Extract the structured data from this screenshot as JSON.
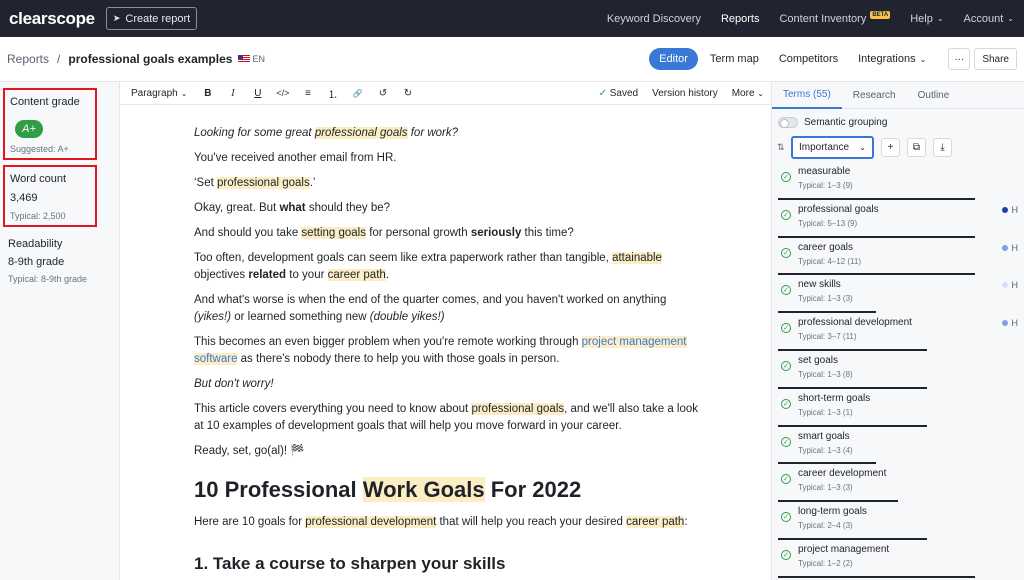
{
  "topnav": {
    "logo": "clearscope",
    "create_label": "Create report",
    "links": [
      {
        "label": "Keyword Discovery"
      },
      {
        "label": "Reports"
      },
      {
        "label": "Content Inventory",
        "badge": "BETA"
      },
      {
        "label": "Help"
      },
      {
        "label": "Account"
      }
    ]
  },
  "subhead": {
    "root": "Reports",
    "separator": "/",
    "page": "professional goals examples",
    "lang": "EN",
    "tabs": [
      "Editor",
      "Term map",
      "Competitors",
      "Integrations"
    ],
    "more_label": "···",
    "share_label": "Share"
  },
  "metrics": {
    "grade": {
      "label": "Content grade",
      "value": "A+",
      "sub": "Suggested: A+"
    },
    "wordcount": {
      "label": "Word count",
      "value": "3,469",
      "sub": "Typical: 2,500"
    },
    "readability": {
      "label": "Readability",
      "value": "8-9th grade",
      "sub": "Typical: 8-9th grade"
    }
  },
  "toolbar": {
    "paragraph": "Paragraph",
    "icons": [
      "B",
      "I",
      "U",
      "</>",
      "≡",
      "⒈",
      "🔗",
      "↺",
      "↻"
    ],
    "saved": "Saved",
    "version": "Version history",
    "more": "More"
  },
  "doc": {
    "p1a": "Looking for some great ",
    "p1b": "professional goals",
    "p1c": " for work?",
    "p2": "You've received another email from HR.",
    "p3a": "‘Set ",
    "p3b": "professional goals",
    "p3c": ".’",
    "p4a": "Okay, great. But ",
    "p4b": "what",
    "p4c": " should they be?",
    "p5a": "And should you take ",
    "p5b": "setting goals",
    "p5c": " for personal growth ",
    "p5d": "seriously",
    "p5e": " this time?",
    "p6a": "Too often, development goals can seem like extra paperwork rather than tangible, ",
    "p6b": "attainable",
    "p6c": " objectives ",
    "p6d": "related",
    "p6e": " to your ",
    "p6f": "career path",
    "p6g": ".",
    "p7a": "And what's worse is when the end of the quarter comes, and you haven't worked on anything ",
    "p7b": "(yikes!)",
    "p7c": " or learned something new ",
    "p7d": "(double yikes!)",
    "p8a": "This becomes an even bigger problem when you're remote working through ",
    "p8b": "project management software",
    "p8c": " as there's nobody there to help you with those goals in person.",
    "p9": "But don't worry!",
    "p10a": "This article covers everything you need to know about ",
    "p10b": "professional goals",
    "p10c": ", and we'll also take a look at 10 examples of development goals that will help you move forward in your career.",
    "p11": "Ready, set, go(al)! 🏁",
    "h2a": "10 Professional ",
    "h2b": "Work Goals",
    "h2c": " For 2022",
    "p12a": "Here are 10 goals for ",
    "p12b": "professional development",
    "p12c": " that will help you reach your desired ",
    "p12d": "career path",
    "p12e": ":",
    "h3": "1. Take a course to sharpen your skills"
  },
  "rightpanel": {
    "tabs": [
      "Terms (55)",
      "Research",
      "Outline"
    ],
    "semantic_label": "Semantic grouping",
    "sort_label": "Importance",
    "terms": [
      {
        "name": "measurable",
        "typical": "Typical: 1–3 (9)",
        "usage": 0.82,
        "prio": "",
        "dot": ""
      },
      {
        "name": "professional goals",
        "typical": "Typical: 5–13 (9)",
        "usage": 0.82,
        "prio": "H",
        "dot": "#1f3fa8"
      },
      {
        "name": "career goals",
        "typical": "Typical: 4–12 (11)",
        "usage": 0.82,
        "prio": "H",
        "dot": "#7ea1e6"
      },
      {
        "name": "new skills",
        "typical": "Typical: 1–3 (3)",
        "usage": 0.41,
        "prio": "H",
        "dot": "#d6e0f5"
      },
      {
        "name": "professional development",
        "typical": "Typical: 3–7 (11)",
        "usage": 0.62,
        "prio": "H",
        "dot": "#7ea1e6"
      },
      {
        "name": "set goals",
        "typical": "Typical: 1–3 (8)",
        "usage": 0.62,
        "prio": "",
        "dot": ""
      },
      {
        "name": "short-term goals",
        "typical": "Typical: 1–3 (1)",
        "usage": 0.62,
        "prio": "",
        "dot": ""
      },
      {
        "name": "smart goals",
        "typical": "Typical: 1–3 (4)",
        "usage": 0.41,
        "prio": "",
        "dot": ""
      },
      {
        "name": "career development",
        "typical": "Typical: 1–3 (3)",
        "usage": 0.5,
        "prio": "",
        "dot": ""
      },
      {
        "name": "long-term goals",
        "typical": "Typical: 2–4 (3)",
        "usage": 0.62,
        "prio": "",
        "dot": ""
      },
      {
        "name": "project management",
        "typical": "Typical: 1–2 (2)",
        "usage": 0.82,
        "prio": "",
        "dot": ""
      }
    ]
  }
}
